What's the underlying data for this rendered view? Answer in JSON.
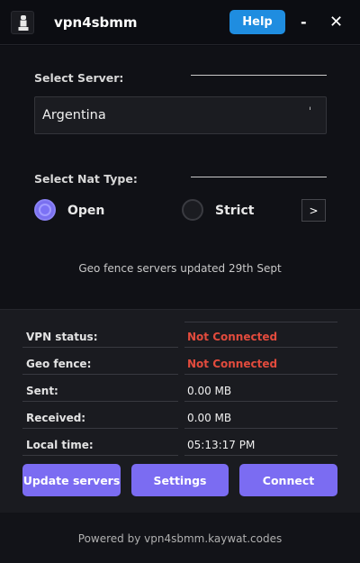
{
  "app": {
    "title": "vpn4sbmm",
    "help_label": "Help",
    "minimize_glyph": "-",
    "close_glyph": "✕"
  },
  "server": {
    "section_label": "Select Server:",
    "selected": "Argentina"
  },
  "nat": {
    "section_label": "Select Nat Type:",
    "options": [
      {
        "label": "Open",
        "checked": true
      },
      {
        "label": "Strict",
        "checked": false
      }
    ],
    "next_label": ">"
  },
  "geo_note": "Geo fence servers updated 29th Sept",
  "status": [
    {
      "key": "VPN status:",
      "value": "Not Connected"
    },
    {
      "key": "Geo fence:",
      "value": "Not Connected"
    },
    {
      "key": "Sent:",
      "value": "0.00 MB"
    },
    {
      "key": "Received:",
      "value": "0.00 MB"
    },
    {
      "key": "Local time:",
      "value": "05:13:17 PM"
    }
  ],
  "actions": {
    "update_label": "Update servers",
    "settings_label": "Settings",
    "connect_label": "Connect"
  },
  "footer": "Powered by vpn4sbmm.kaywat.codes",
  "colors": {
    "accent": "#7b6cf2",
    "help": "#1f8de0",
    "error": "#e24b3d"
  }
}
